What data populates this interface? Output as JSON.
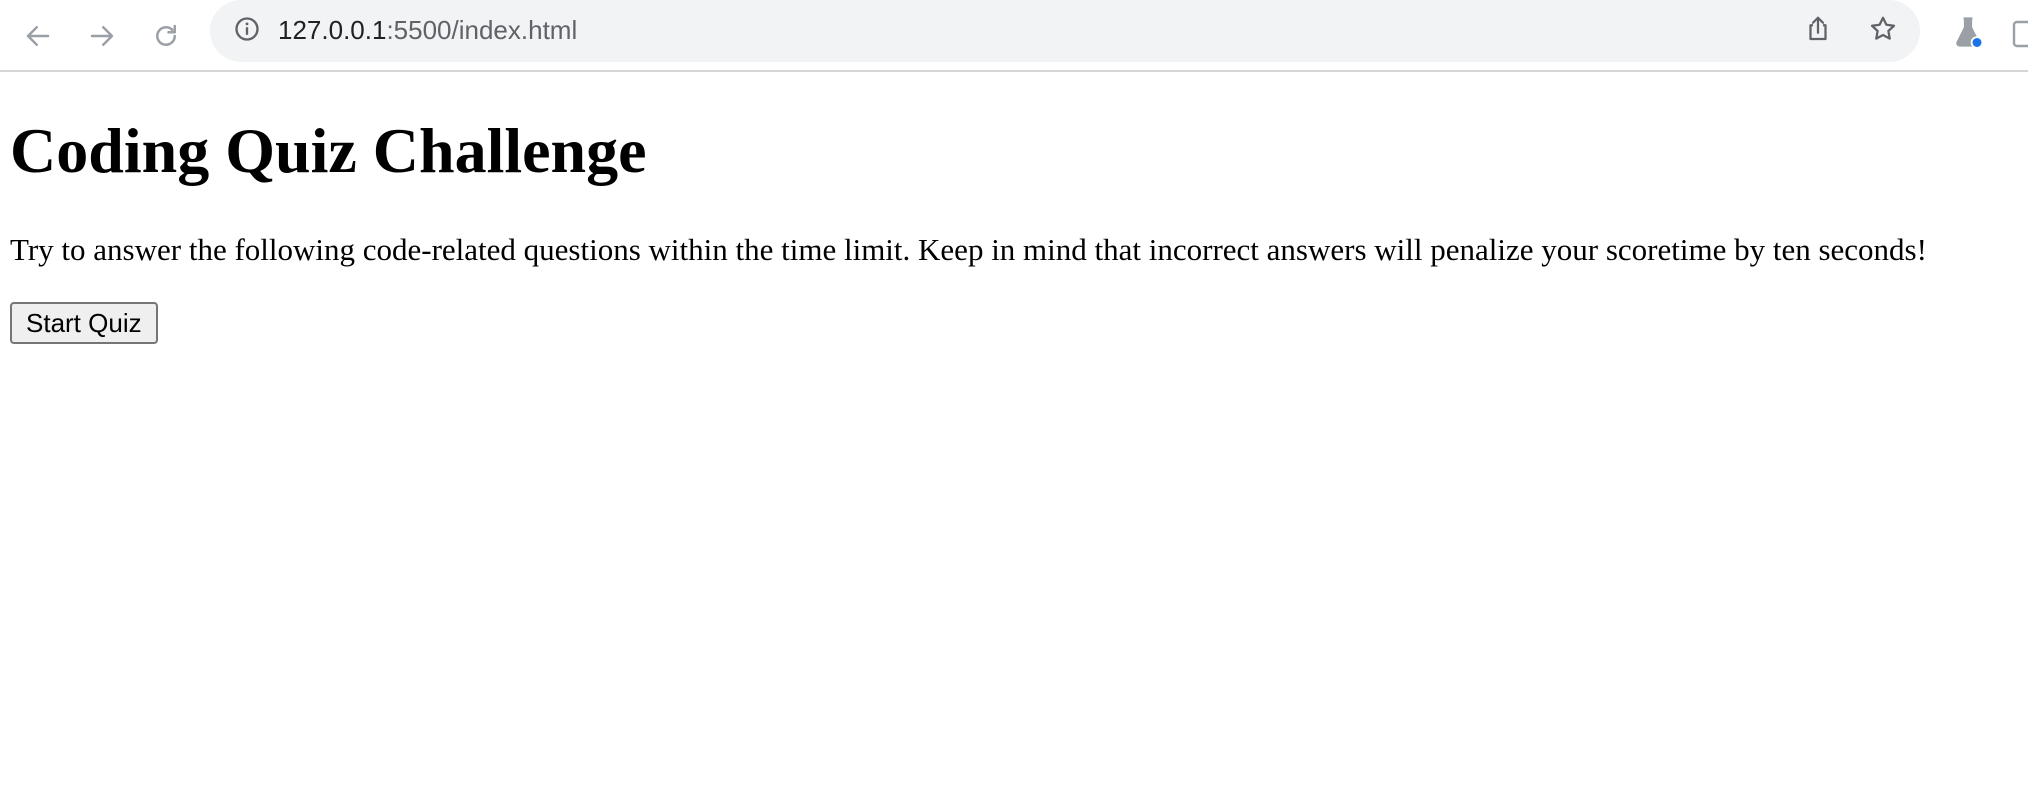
{
  "browser": {
    "url_host": "127.0.0.1",
    "url_rest": ":5500/index.html",
    "icons": {
      "back": "arrow-left-icon",
      "forward": "arrow-right-icon",
      "reload": "reload-icon",
      "site_info": "info-icon",
      "share": "share-icon",
      "bookmark": "star-icon",
      "extension": "flask-icon",
      "side_panel": "side-panel-icon"
    },
    "colors": {
      "omnibox_bg": "#f1f3f4",
      "icon_gray": "#5f6368",
      "icon_disabled": "#9aa0a6",
      "extension_badge": "#1a73e8"
    }
  },
  "page": {
    "title": "Coding Quiz Challenge",
    "intro": "Try to answer the following code-related questions within the time limit. Keep in mind that incorrect answers will penalize your scoretime by ten seconds!",
    "start_button_label": "Start Quiz"
  }
}
